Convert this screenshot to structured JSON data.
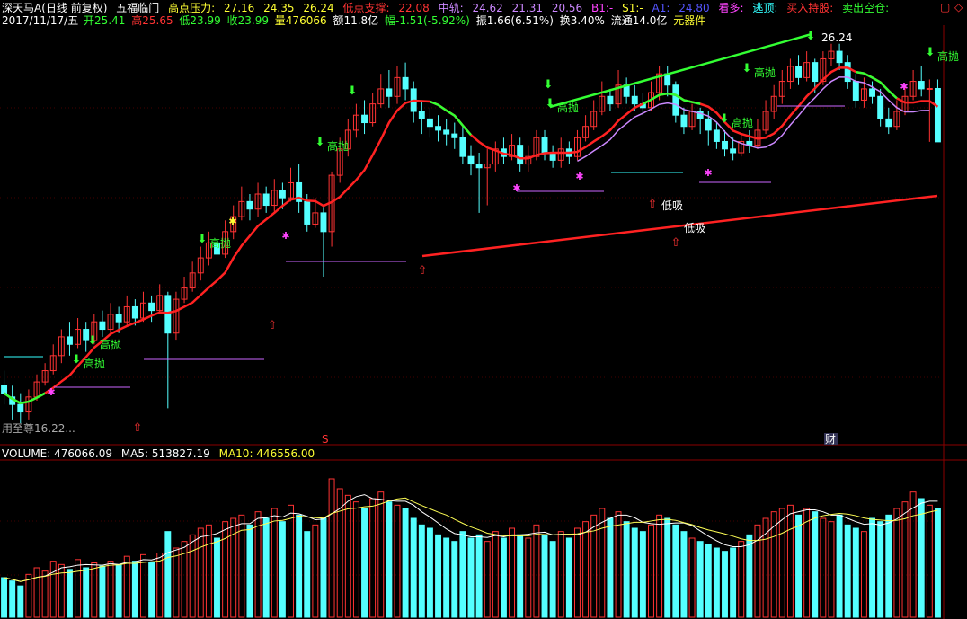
{
  "header": {
    "stock_name": "深天马A(日线 前复权)",
    "indicator_name": "五福临门",
    "high_pressure_label": "高点压力:",
    "high_pressure_values": [
      "27.16",
      "24.35",
      "26.24"
    ],
    "low_support_label": "低点支撑:",
    "low_support_value": "22.08",
    "mid_rail_label": "中轨:",
    "mid_rail_values": [
      "24.62",
      "21.31",
      "20.56"
    ],
    "b1_label": "B1:-",
    "s1_label": "S1:-",
    "a1_label": "A1:",
    "a1_value": "24.80",
    "look_long": "看多:",
    "escape_top": "逃顶:",
    "buy_hold": "买入持股:",
    "sell_short": "卖出空仓:",
    "corner_marks": [
      "▢",
      "◇"
    ]
  },
  "quote": {
    "date": "2017/11/17/五",
    "open": "开25.41",
    "high": "高25.65",
    "low": "低23.99",
    "close": "收23.99",
    "volume": "量476066",
    "amount": "额11.8亿",
    "change": "幅-1.51(-5.92%)",
    "amplitude": "振1.66(6.51%)",
    "turnover": "换3.40%",
    "float": "流通14.0亿",
    "sector": "元器件"
  },
  "annotations": {
    "high_sell": "高抛",
    "low_buy": "低吸",
    "peak_label": "26.24",
    "bottom_label": "用至尊16.22...",
    "event_s": "S",
    "event_cai": "财"
  },
  "volume_header": {
    "volume": "VOLUME: 476066.09",
    "ma5": "MA5: 513827.19",
    "ma10": "MA10: 446556.00"
  },
  "colors": {
    "up": "#ff3333",
    "down": "#54ffff",
    "ma_red": "#ff2222",
    "ma_green": "#33ff33",
    "ma_violet": "#cc88ff",
    "vol_ma5": "#ffffff",
    "vol_ma10": "#ffff55"
  },
  "chart_data": {
    "type": "candlestick",
    "title": "深天马A 日线",
    "price_range": [
      16.0,
      27.0
    ],
    "candles": [
      [
        17.5,
        17.3,
        17.9,
        17.0
      ],
      [
        17.2,
        17.0,
        17.5,
        16.6
      ],
      [
        17.0,
        16.8,
        17.3,
        16.5
      ],
      [
        16.8,
        17.2,
        17.4,
        16.6
      ],
      [
        17.2,
        17.6,
        17.8,
        17.1
      ],
      [
        17.6,
        17.9,
        18.1,
        17.5
      ],
      [
        17.9,
        18.3,
        18.6,
        17.8
      ],
      [
        18.3,
        18.8,
        19.0,
        18.1
      ],
      [
        18.8,
        18.6,
        19.2,
        18.3
      ],
      [
        18.6,
        19.0,
        19.3,
        18.5
      ],
      [
        19.0,
        18.7,
        19.2,
        18.4
      ],
      [
        18.7,
        19.2,
        19.4,
        18.6
      ],
      [
        19.2,
        19.0,
        19.5,
        18.8
      ],
      [
        19.0,
        19.4,
        19.7,
        18.9
      ],
      [
        19.4,
        19.2,
        19.6,
        18.9
      ],
      [
        19.2,
        19.6,
        19.9,
        19.1
      ],
      [
        19.6,
        19.3,
        19.8,
        19.1
      ],
      [
        19.3,
        19.7,
        20.0,
        19.2
      ],
      [
        19.7,
        19.5,
        19.9,
        19.2
      ],
      [
        19.5,
        19.9,
        20.2,
        19.4
      ],
      [
        19.9,
        18.9,
        20.0,
        16.9
      ],
      [
        18.9,
        19.8,
        20.0,
        18.7
      ],
      [
        19.8,
        20.1,
        20.4,
        19.7
      ],
      [
        20.1,
        20.5,
        20.8,
        20.0
      ],
      [
        20.5,
        20.9,
        21.2,
        20.3
      ],
      [
        20.9,
        21.3,
        21.6,
        20.7
      ],
      [
        21.3,
        21.0,
        21.5,
        20.8
      ],
      [
        21.0,
        21.6,
        21.9,
        20.9
      ],
      [
        21.6,
        22.0,
        22.3,
        21.4
      ],
      [
        22.0,
        22.4,
        22.8,
        21.9
      ],
      [
        22.4,
        22.2,
        22.6,
        21.9
      ],
      [
        22.2,
        22.6,
        22.9,
        22.0
      ],
      [
        22.6,
        22.3,
        22.8,
        22.1
      ],
      [
        22.3,
        22.7,
        23.0,
        22.1
      ],
      [
        22.7,
        22.5,
        22.9,
        22.2
      ],
      [
        22.5,
        22.9,
        23.3,
        22.4
      ],
      [
        22.9,
        22.4,
        23.4,
        22.1
      ],
      [
        22.4,
        21.8,
        22.6,
        21.6
      ],
      [
        21.8,
        22.1,
        22.5,
        21.7
      ],
      [
        22.1,
        21.6,
        22.3,
        20.4
      ],
      [
        21.6,
        23.1,
        23.2,
        21.2
      ],
      [
        23.1,
        23.8,
        24.1,
        22.9
      ],
      [
        23.8,
        24.3,
        24.6,
        23.6
      ],
      [
        24.3,
        24.7,
        25.0,
        24.1
      ],
      [
        24.7,
        24.5,
        25.1,
        24.2
      ],
      [
        24.5,
        25.0,
        25.3,
        24.4
      ],
      [
        25.0,
        25.4,
        25.8,
        24.9
      ],
      [
        25.4,
        25.2,
        25.9,
        24.9
      ],
      [
        25.2,
        25.7,
        26.0,
        25.0
      ],
      [
        25.7,
        25.4,
        26.1,
        25.1
      ],
      [
        25.4,
        24.8,
        25.6,
        24.5
      ],
      [
        24.8,
        24.6,
        25.1,
        24.2
      ],
      [
        24.6,
        24.4,
        24.9,
        24.1
      ],
      [
        24.4,
        24.3,
        24.7,
        24.0
      ],
      [
        24.3,
        24.2,
        24.6,
        23.9
      ],
      [
        24.2,
        24.1,
        24.5,
        23.8
      ],
      [
        24.1,
        23.6,
        24.4,
        23.4
      ],
      [
        23.6,
        23.4,
        23.9,
        23.1
      ],
      [
        23.4,
        23.3,
        23.7,
        22.1
      ],
      [
        23.3,
        23.4,
        23.8,
        22.3
      ],
      [
        23.4,
        23.8,
        24.0,
        23.2
      ],
      [
        23.8,
        23.6,
        24.1,
        23.4
      ],
      [
        23.6,
        23.9,
        24.2,
        23.5
      ],
      [
        23.9,
        23.4,
        24.1,
        23.2
      ],
      [
        23.4,
        23.6,
        23.9,
        23.2
      ],
      [
        23.6,
        24.1,
        24.3,
        23.5
      ],
      [
        24.1,
        23.7,
        24.3,
        23.5
      ],
      [
        23.7,
        23.5,
        23.9,
        23.3
      ],
      [
        23.5,
        23.8,
        24.1,
        23.3
      ],
      [
        23.8,
        23.6,
        24.0,
        23.4
      ],
      [
        23.6,
        24.1,
        24.3,
        23.5
      ],
      [
        24.1,
        24.4,
        24.7,
        24.0
      ],
      [
        24.4,
        24.8,
        25.1,
        24.3
      ],
      [
        24.8,
        25.2,
        25.6,
        24.7
      ],
      [
        25.2,
        25.0,
        25.4,
        24.8
      ],
      [
        25.0,
        25.5,
        25.9,
        24.9
      ],
      [
        25.5,
        25.2,
        25.7,
        25.0
      ],
      [
        25.2,
        25.0,
        25.5,
        24.8
      ],
      [
        25.0,
        24.9,
        25.3,
        24.7
      ],
      [
        24.9,
        25.3,
        25.6,
        24.8
      ],
      [
        25.3,
        25.8,
        26.0,
        25.1
      ],
      [
        25.8,
        25.5,
        26.0,
        25.2
      ],
      [
        25.5,
        24.7,
        25.6,
        24.5
      ],
      [
        24.7,
        24.4,
        24.9,
        24.2
      ],
      [
        24.4,
        24.8,
        25.0,
        24.3
      ],
      [
        24.8,
        24.6,
        24.9,
        24.2
      ],
      [
        24.6,
        24.3,
        24.8,
        23.9
      ],
      [
        24.3,
        24.0,
        24.5,
        23.8
      ],
      [
        24.0,
        23.8,
        24.3,
        23.6
      ],
      [
        23.8,
        23.7,
        24.1,
        23.5
      ],
      [
        23.7,
        24.0,
        24.2,
        23.6
      ],
      [
        24.0,
        23.9,
        24.3,
        23.7
      ],
      [
        23.9,
        24.3,
        24.6,
        23.8
      ],
      [
        24.3,
        24.8,
        25.1,
        24.2
      ],
      [
        24.8,
        25.2,
        25.5,
        24.6
      ],
      [
        25.2,
        25.6,
        25.9,
        25.0
      ],
      [
        25.6,
        26.0,
        26.2,
        25.4
      ],
      [
        26.0,
        25.7,
        26.3,
        25.5
      ],
      [
        25.7,
        26.1,
        26.4,
        25.6
      ],
      [
        26.1,
        25.6,
        26.2,
        25.3
      ],
      [
        25.6,
        26.2,
        26.4,
        25.5
      ],
      [
        26.2,
        26.4,
        26.6,
        26.0
      ],
      [
        26.4,
        26.1,
        26.6,
        25.9
      ],
      [
        26.1,
        25.6,
        26.3,
        25.4
      ],
      [
        25.6,
        25.1,
        25.8,
        24.9
      ],
      [
        25.1,
        25.4,
        25.7,
        24.9
      ],
      [
        25.4,
        25.2,
        25.6,
        25.0
      ],
      [
        25.2,
        24.6,
        25.4,
        24.4
      ],
      [
        24.6,
        24.4,
        24.9,
        24.2
      ],
      [
        24.4,
        24.8,
        25.1,
        24.3
      ],
      [
        24.8,
        25.2,
        25.5,
        24.7
      ],
      [
        25.2,
        25.6,
        25.9,
        25.1
      ],
      [
        25.6,
        25.4,
        26.0,
        25.2
      ],
      [
        25.4,
        25.41,
        25.65,
        23.99
      ],
      [
        25.41,
        23.99,
        25.65,
        23.99
      ]
    ],
    "volume": [
      120,
      110,
      95,
      130,
      150,
      140,
      170,
      160,
      145,
      175,
      150,
      165,
      155,
      170,
      160,
      185,
      170,
      190,
      165,
      195,
      260,
      210,
      230,
      250,
      270,
      280,
      240,
      290,
      300,
      310,
      280,
      320,
      300,
      330,
      290,
      340,
      310,
      260,
      280,
      300,
      420,
      390,
      370,
      350,
      330,
      360,
      380,
      350,
      340,
      330,
      300,
      280,
      270,
      250,
      240,
      230,
      260,
      240,
      250,
      230,
      260,
      240,
      270,
      250,
      240,
      280,
      250,
      230,
      260,
      240,
      270,
      290,
      310,
      330,
      300,
      320,
      290,
      270,
      260,
      280,
      310,
      300,
      280,
      260,
      240,
      230,
      220,
      210,
      200,
      210,
      230,
      250,
      280,
      300,
      320,
      330,
      340,
      310,
      330,
      320,
      300,
      290,
      310,
      280,
      270,
      260,
      300,
      290,
      310,
      330,
      350,
      380,
      360,
      340,
      330
    ],
    "ma5_value": 513827.19,
    "ma10_value": 446556.0,
    "volume_value": 476066.09
  }
}
